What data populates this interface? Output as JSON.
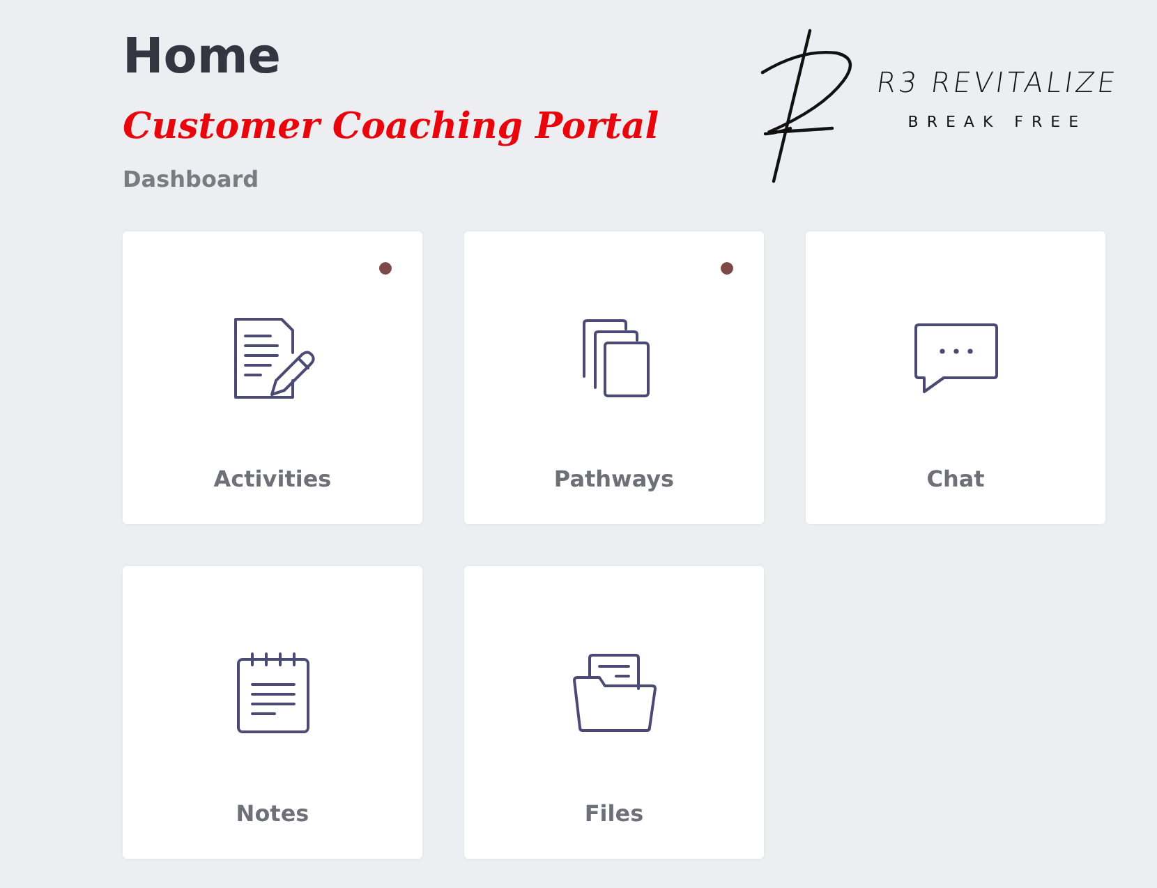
{
  "header": {
    "title": "Home",
    "subtitle": "Customer Coaching Portal",
    "breadcrumb": "Dashboard"
  },
  "logo": {
    "name": "R3 REVITALIZE",
    "tagline": "BREAK FREE"
  },
  "tiles": [
    {
      "label": "Activities",
      "kind": "document",
      "unread": true
    },
    {
      "label": "Pathways",
      "kind": "pages",
      "unread": true
    },
    {
      "label": "Chat",
      "kind": "bubble",
      "unread": false
    },
    {
      "label": "Notes",
      "kind": "notepad",
      "unread": false
    },
    {
      "label": "Files",
      "kind": "folder",
      "unread": false
    }
  ]
}
